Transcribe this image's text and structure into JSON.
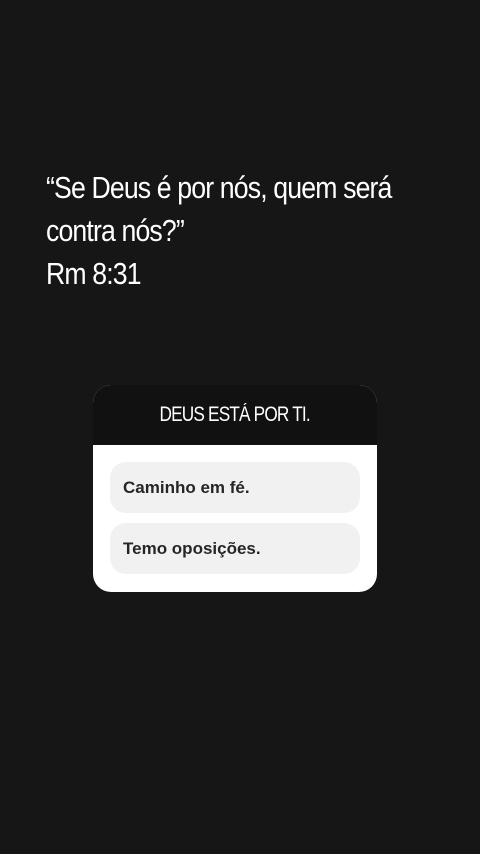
{
  "quote": {
    "line1": "“Se Deus é por nós, quem será",
    "line2": "contra nós?”",
    "reference": "Rm 8:31"
  },
  "poll": {
    "question": "DEUS ESTÁ POR TI.",
    "options": [
      {
        "label": "Caminho em fé."
      },
      {
        "label": "Temo oposições."
      }
    ]
  },
  "colors": {
    "background": "#161616",
    "text": "#ffffff",
    "poll_header": "#111111",
    "poll_body": "#ffffff",
    "option_bg": "#f1f1f1",
    "option_text": "#262626"
  }
}
